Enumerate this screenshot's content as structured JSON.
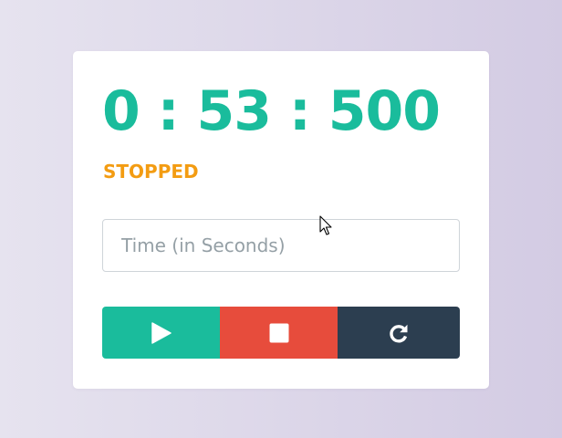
{
  "timer": {
    "display": "0 : 53 : 500",
    "status": "STOPPED"
  },
  "time_input": {
    "value": "",
    "placeholder": "Time (in Seconds)"
  },
  "controls": {
    "play_icon": "play-icon",
    "stop_icon": "stop-icon",
    "reset_icon": "reset-icon"
  },
  "colors": {
    "timer_text": "#1abc9c",
    "status_text": "#f39c12",
    "play_button": "#1abc9c",
    "stop_button": "#e74c3c",
    "reset_button": "#2c3e50"
  }
}
